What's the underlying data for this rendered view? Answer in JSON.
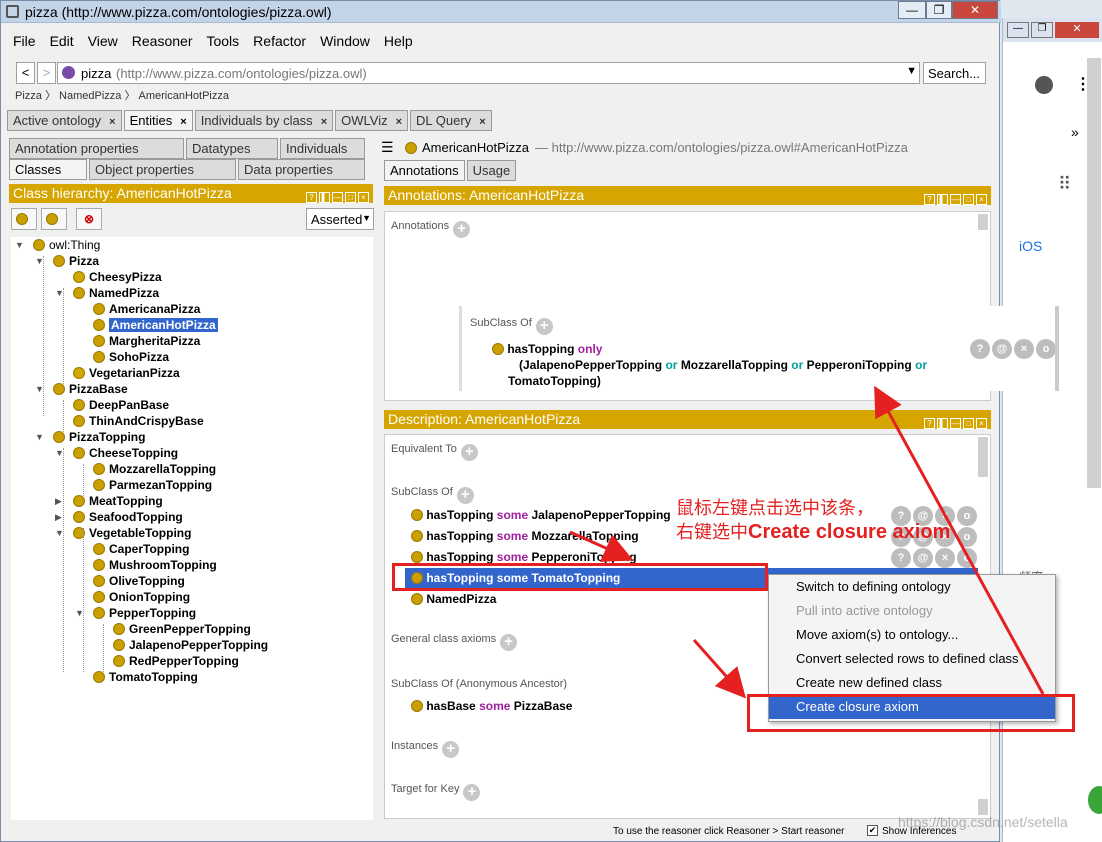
{
  "window": {
    "title": "pizza (http://www.pizza.com/ontologies/pizza.owl)"
  },
  "menu": [
    "File",
    "Edit",
    "View",
    "Reasoner",
    "Tools",
    "Refactor",
    "Window",
    "Help"
  ],
  "nav": {
    "back": "<",
    "forward": ">",
    "ontology_name": "pizza",
    "ontology_iri": "(http://www.pizza.com/ontologies/pizza.owl)",
    "search": "Search..."
  },
  "breadcrumb": [
    "Pizza",
    "NamedPizza",
    "AmericanHotPizza"
  ],
  "main_tabs": [
    {
      "label": "Active ontology",
      "close": "×"
    },
    {
      "label": "Entities",
      "close": "×"
    },
    {
      "label": "Individuals by class",
      "close": "×"
    },
    {
      "label": "OWLViz",
      "close": "×"
    },
    {
      "label": "DL Query",
      "close": "×"
    }
  ],
  "left": {
    "subtabs_row1": [
      "Annotation properties",
      "Datatypes",
      "Individuals"
    ],
    "subtabs_row2": [
      "Classes",
      "Object properties",
      "Data properties"
    ],
    "hierarchy_title": "Class hierarchy: AmericanHotPizza",
    "asserted": "Asserted",
    "tree": [
      {
        "label": "owl:Thing"
      },
      {
        "label": "Pizza"
      },
      {
        "label": "CheesyPizza"
      },
      {
        "label": "NamedPizza"
      },
      {
        "label": "AmericanaPizza"
      },
      {
        "label": "AmericanHotPizza"
      },
      {
        "label": "MargheritaPizza"
      },
      {
        "label": "SohoPizza"
      },
      {
        "label": "VegetarianPizza"
      },
      {
        "label": "PizzaBase"
      },
      {
        "label": "DeepPanBase"
      },
      {
        "label": "ThinAndCrispyBase"
      },
      {
        "label": "PizzaTopping"
      },
      {
        "label": "CheeseTopping"
      },
      {
        "label": "MozzarellaTopping"
      },
      {
        "label": "ParmezanTopping"
      },
      {
        "label": "MeatTopping"
      },
      {
        "label": "SeafoodTopping"
      },
      {
        "label": "VegetableTopping"
      },
      {
        "label": "CaperTopping"
      },
      {
        "label": "MushroomTopping"
      },
      {
        "label": "OliveTopping"
      },
      {
        "label": "OnionTopping"
      },
      {
        "label": "PepperTopping"
      },
      {
        "label": "GreenPepperTopping"
      },
      {
        "label": "JalapenoPepperTopping"
      },
      {
        "label": "RedPepperTopping"
      },
      {
        "label": "TomatoTopping"
      }
    ]
  },
  "right": {
    "entity_name": "AmericanHotPizza",
    "entity_iri": "— http://www.pizza.com/ontologies/pizza.owl#AmericanHotPizza",
    "tabs": [
      "Annotations",
      "Usage"
    ],
    "annotations_title": "Annotations: AmericanHotPizza",
    "annotations_label": "Annotations",
    "popup": {
      "subclass_label": "SubClass Of",
      "prop": "hasTopping",
      "only": "only",
      "line2_open": "(JalapenoPepperTopping",
      "or": "or",
      "mozz": "MozzarellaTopping",
      "pep": "PepperoniTopping",
      "line3": "TomatoTopping)"
    },
    "description_title": "Description: AmericanHotPizza",
    "sections": {
      "equivalent": "Equivalent To",
      "subclass": "SubClass Of",
      "general": "General class axioms",
      "anon": "SubClass Of (Anonymous Ancestor)",
      "instances": "Instances",
      "target": "Target for Key"
    },
    "subclass_rows": [
      {
        "prop": "hasTopping",
        "kw": "some",
        "filler": "JalapenoPepperTopping"
      },
      {
        "prop": "hasTopping",
        "kw": "some",
        "filler": "MozzarellaTopping"
      },
      {
        "prop": "hasTopping",
        "kw": "some",
        "filler": "PepperoniTopping"
      },
      {
        "prop": "hasTopping",
        "kw": "some",
        "filler": "TomatoTopping"
      }
    ],
    "named_row": "NamedPizza",
    "anon_row": {
      "prop": "hasBase",
      "kw": "some",
      "filler": "PizzaBase"
    },
    "row_buttons": [
      "?",
      "@",
      "×",
      "o"
    ]
  },
  "context_menu": [
    {
      "label": "Switch to defining ontology",
      "disabled": false
    },
    {
      "label": "Pull into active ontology",
      "disabled": true
    },
    {
      "label": "Move axiom(s) to ontology...",
      "disabled": false
    },
    {
      "label": "Convert selected rows to defined class",
      "disabled": false
    },
    {
      "label": "Create new defined class",
      "disabled": false
    },
    {
      "label": "Create closure axiom",
      "disabled": false,
      "highlighted": true
    }
  ],
  "annotation_text": {
    "line1": "鼠标左键点击选中该条，",
    "line2_prefix": "右键选中",
    "line2_bold": "Create closure axiom"
  },
  "status": {
    "hint": "To use the reasoner click Reasoner > Start reasoner",
    "checkbox": "✔",
    "show_inferences": "Show Inferences"
  },
  "watermark": "https://blog.csdn.net/setella",
  "background_window": {
    "ios": "iOS",
    "chevrons": "»",
    "freq": "频率"
  },
  "colors": {
    "accent": "#d6a500",
    "selection": "#3366cc",
    "annotation_red": "#e52020",
    "class_dot": "#c9a000"
  }
}
